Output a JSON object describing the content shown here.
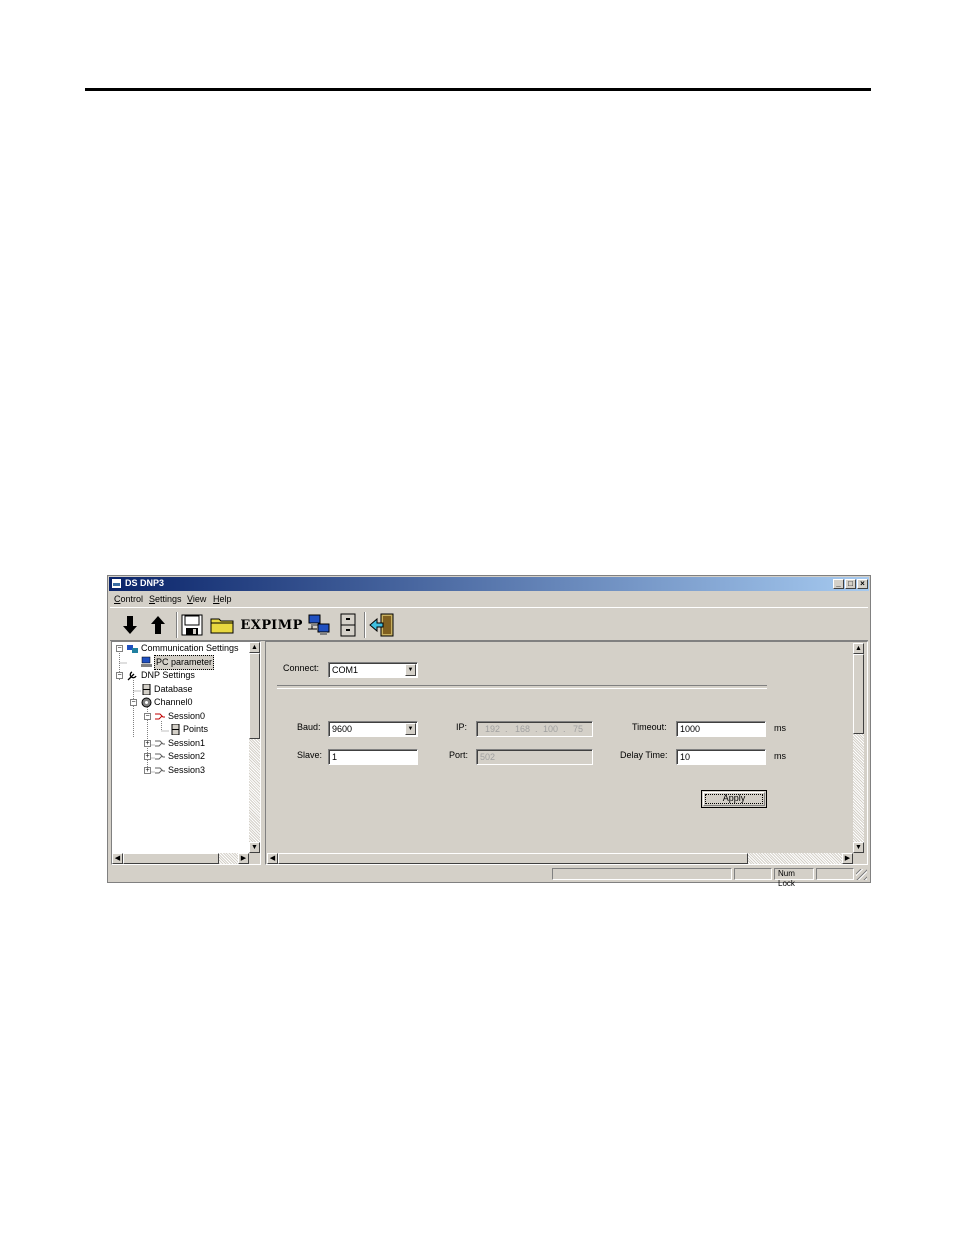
{
  "window": {
    "title": "DS DNP3",
    "controls": {
      "minimize": "_",
      "maximize": "□",
      "close": "×"
    }
  },
  "menu": [
    {
      "label": "Control",
      "accel": "C",
      "rest": "ontrol"
    },
    {
      "label": "Settings",
      "accel": "S",
      "rest": "ettings"
    },
    {
      "label": "View",
      "accel": "V",
      "rest": "iew"
    },
    {
      "label": "Help",
      "accel": "H",
      "rest": "elp"
    }
  ],
  "toolbar": {
    "download_icon": "arrow-down-icon",
    "upload_icon": "arrow-up-icon",
    "save_icon": "floppy-disk-icon",
    "open_icon": "folder-icon",
    "exp_label": "EXP",
    "imp_label": "IMP",
    "network_icon": "network-computers-icon",
    "cabinet_icon": "file-cabinet-icon",
    "exit_icon": "exit-door-icon"
  },
  "tree": {
    "items": [
      {
        "label": "Communication Settings",
        "expander": "−",
        "icon": "network-icon"
      },
      {
        "label": "PC parameter",
        "icon": "computer-icon",
        "selected": true
      },
      {
        "label": "DNP Settings",
        "expander": "−",
        "icon": "tools-icon"
      },
      {
        "label": "Database",
        "icon": "database-icon"
      },
      {
        "label": "Channel0",
        "expander": "−",
        "icon": "channel-icon"
      },
      {
        "label": "Session0",
        "expander": "−",
        "icon": "session-icon"
      },
      {
        "label": "Points",
        "icon": "points-icon"
      },
      {
        "label": "Session1",
        "expander": "+",
        "icon": "session-icon"
      },
      {
        "label": "Session2",
        "expander": "+",
        "icon": "session-icon"
      },
      {
        "label": "Session3",
        "expander": "+",
        "icon": "session-icon"
      }
    ]
  },
  "form": {
    "connect_label": "Connect:",
    "connect_value": "COM1",
    "baud_label": "Baud:",
    "baud_value": "9600",
    "slave_label": "Slave:",
    "slave_value": "1",
    "ip_label": "IP:",
    "ip_octets": [
      "192",
      "168",
      "100",
      "75"
    ],
    "ip_dot": ".",
    "port_label": "Port:",
    "port_value": "502",
    "timeout_label": "Timeout:",
    "timeout_value": "1000",
    "timeout_unit": "ms",
    "delay_label": "Delay Time:",
    "delay_value": "10",
    "delay_unit": "ms",
    "apply_label": "Apply"
  },
  "statusbar": {
    "num_lock": "Num Lock"
  },
  "colors": {
    "titlebar_start": "#0a246a",
    "titlebar_end": "#a6caf0",
    "face": "#d4d0c8"
  }
}
